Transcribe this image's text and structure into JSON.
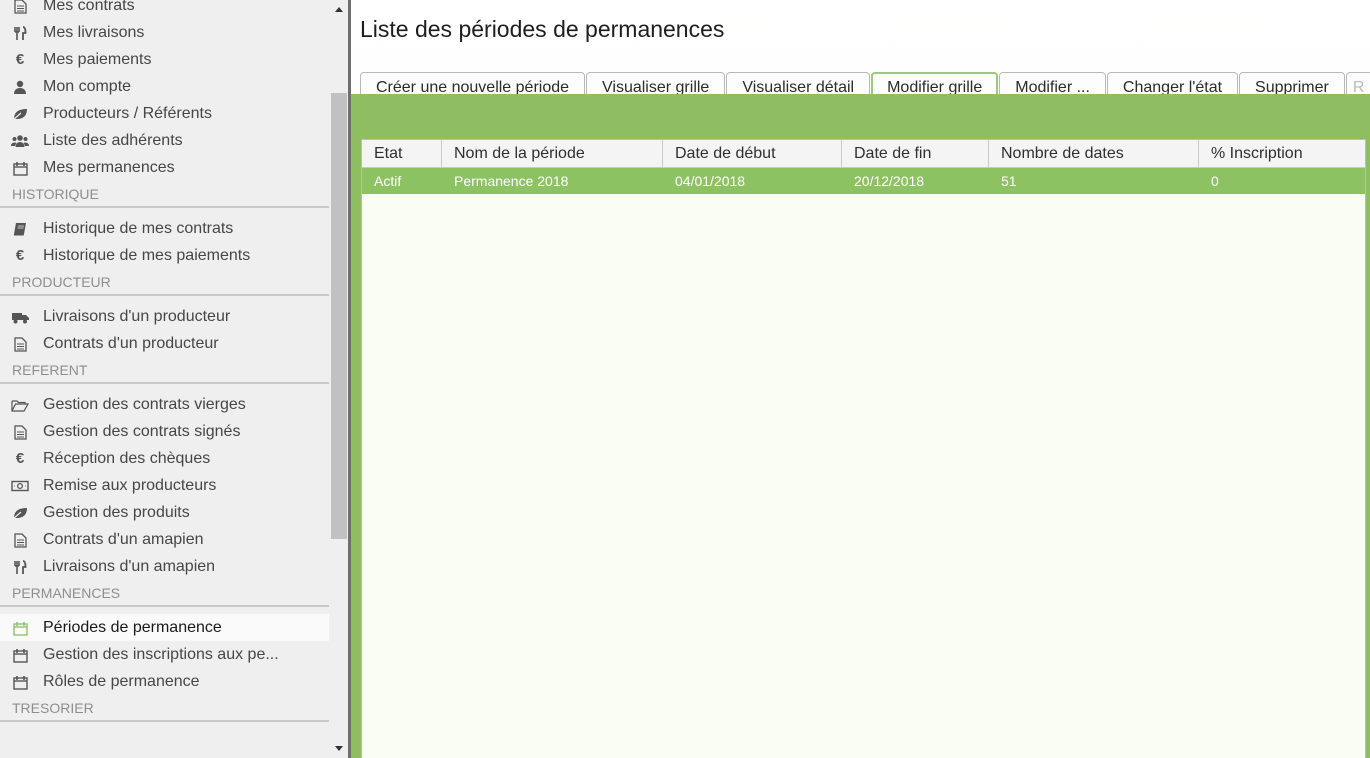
{
  "sidebar": {
    "items": [
      {
        "label": "Mes contrats",
        "icon": "file-text-icon"
      },
      {
        "label": "Mes livraisons",
        "icon": "cutlery-icon"
      },
      {
        "label": "Mes paiements",
        "icon": "euro-icon"
      },
      {
        "label": "Mon compte",
        "icon": "user-icon"
      },
      {
        "label": "Producteurs / Référents",
        "icon": "leaf-icon"
      },
      {
        "label": "Liste des adhérents",
        "icon": "users-icon"
      },
      {
        "label": "Mes permanences",
        "icon": "calendar-icon"
      }
    ],
    "sections": [
      {
        "title": "HISTORIQUE",
        "items": [
          {
            "label": "Historique de mes contrats",
            "icon": "book-icon"
          },
          {
            "label": "Historique de mes paiements",
            "icon": "euro-icon"
          }
        ]
      },
      {
        "title": "PRODUCTEUR",
        "items": [
          {
            "label": "Livraisons d'un producteur",
            "icon": "truck-icon"
          },
          {
            "label": "Contrats d'un producteur",
            "icon": "file-text-icon"
          }
        ]
      },
      {
        "title": "REFERENT",
        "items": [
          {
            "label": "Gestion des contrats vierges",
            "icon": "folder-open-icon"
          },
          {
            "label": "Gestion des contrats signés",
            "icon": "file-text-icon"
          },
          {
            "label": "Réception des chèques",
            "icon": "euro-icon"
          },
          {
            "label": "Remise aux producteurs",
            "icon": "money-icon"
          },
          {
            "label": "Gestion des produits",
            "icon": "leaf-icon"
          },
          {
            "label": "Contrats d'un amapien",
            "icon": "file-text-icon"
          },
          {
            "label": "Livraisons d'un amapien",
            "icon": "cutlery-icon"
          }
        ]
      },
      {
        "title": "PERMANENCES",
        "items": [
          {
            "label": "Périodes de permanence",
            "icon": "calendar-icon",
            "selected": true
          },
          {
            "label": "Gestion des inscriptions aux pe...",
            "icon": "calendar-icon"
          },
          {
            "label": "Rôles de permanence",
            "icon": "calendar-icon"
          }
        ]
      },
      {
        "title": "TRESORIER",
        "items": []
      }
    ]
  },
  "main": {
    "title": "Liste des périodes de permanences",
    "toolbar": [
      {
        "label": "Créer une nouvelle période",
        "name": "create-period-button"
      },
      {
        "label": "Visualiser grille",
        "name": "view-grid-button"
      },
      {
        "label": "Visualiser détail",
        "name": "view-detail-button"
      },
      {
        "label": "Modifier grille",
        "name": "edit-grid-button",
        "focused": true
      },
      {
        "label": "Modifier ...",
        "name": "edit-more-button"
      },
      {
        "label": "Changer l'état",
        "name": "change-state-button"
      },
      {
        "label": "Supprimer",
        "name": "delete-button"
      },
      {
        "label": "R",
        "name": "truncated-button",
        "cut": true
      }
    ],
    "table": {
      "columns": [
        "Etat",
        "Nom de la période",
        "Date de début",
        "Date de fin",
        "Nombre de dates",
        "% Inscription"
      ],
      "rows": [
        [
          "Actif",
          "Permanence 2018",
          "04/01/2018",
          "20/12/2018",
          "51",
          "0"
        ]
      ]
    }
  },
  "colors": {
    "accent": "#8dc263",
    "selected_row_text": "#ffffff",
    "sidebar_bg": "#efefef"
  }
}
